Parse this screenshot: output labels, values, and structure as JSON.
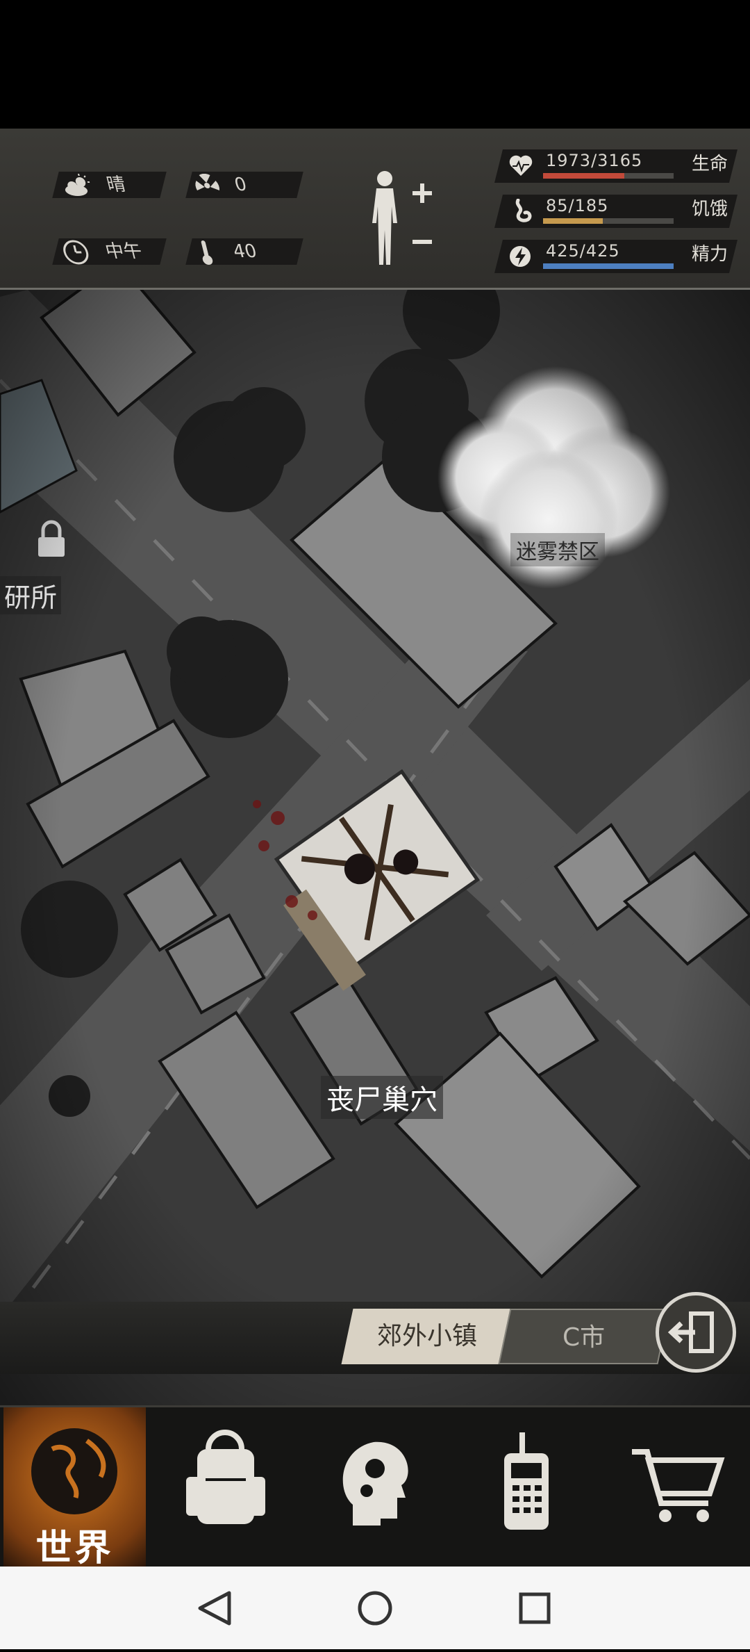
{
  "status": {
    "weather": "晴",
    "radiation": "0",
    "time_of_day": "中午",
    "temperature": "40"
  },
  "stats": [
    {
      "label": "生命",
      "value_text": "1973/3165",
      "current": 1973,
      "max": 3165,
      "color": "#c24a3a",
      "icon": "heart-icon"
    },
    {
      "label": "饥饿",
      "value_text": "85/185",
      "current": 85,
      "max": 185,
      "color": "#c69a4e",
      "icon": "stomach-icon"
    },
    {
      "label": "精力",
      "value_text": "425/425",
      "current": 425,
      "max": 425,
      "color": "#4d7fc0",
      "icon": "energy-icon"
    }
  ],
  "map": {
    "locations": {
      "fog_zone": "迷雾禁区",
      "research": "研所",
      "zombie_nest": "丧尸巢穴"
    }
  },
  "region_tabs": [
    {
      "label": "郊外小镇",
      "active": true
    },
    {
      "label": "C市",
      "active": false
    }
  ],
  "bottom_nav": [
    {
      "label": "世界",
      "icon": "globe-icon",
      "active": true
    },
    {
      "label": "",
      "icon": "backpack-icon",
      "active": false
    },
    {
      "label": "",
      "icon": "skills-head-icon",
      "active": false
    },
    {
      "label": "",
      "icon": "radio-icon",
      "active": false
    },
    {
      "label": "",
      "icon": "cart-icon",
      "active": false
    }
  ],
  "colors": {
    "accent_orange": "#c9721f",
    "hud_bg": "#35342f"
  }
}
